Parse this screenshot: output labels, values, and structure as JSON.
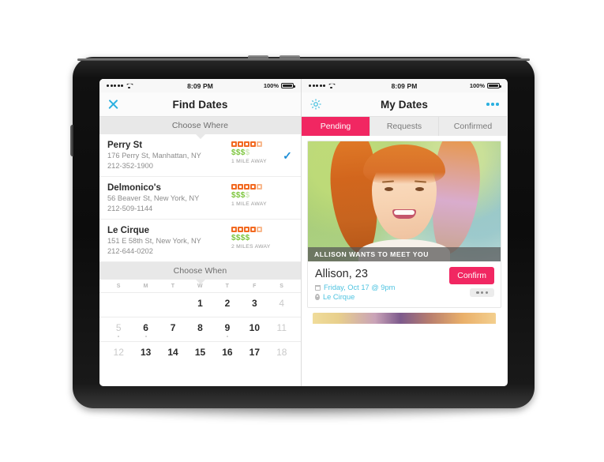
{
  "left_app": {
    "statusbar": {
      "carrier_dots": 5,
      "wifi": "wifi-icon",
      "time": "8:09 PM",
      "battery_pct": "100%"
    },
    "nav": {
      "close_icon": "close-icon",
      "title": "Find Dates"
    },
    "choose_where_label": "Choose Where",
    "restaurants": [
      {
        "name": "Perry St",
        "address": "176 Perry St, Manhattan, NY",
        "phone": "212-352-1900",
        "rating": 4.5,
        "price_on": "$$$",
        "price_off": "$",
        "distance": "1 MILE AWAY",
        "selected": true
      },
      {
        "name": "Delmonico's",
        "address": "56 Beaver St, New York, NY",
        "phone": "212-509-1144",
        "rating": 4.5,
        "price_on": "$$$",
        "price_off": "$",
        "distance": "1 MILE AWAY",
        "selected": false
      },
      {
        "name": "Le Cirque",
        "address": "151 E 58th St, New York, NY",
        "phone": "212-644-0202",
        "rating": 4.5,
        "price_on": "$$$$",
        "price_off": "",
        "distance": "2 MILES AWAY",
        "selected": false
      }
    ],
    "choose_when_label": "Choose When",
    "calendar": {
      "dow": [
        "S",
        "M",
        "T",
        "W",
        "T",
        "F",
        "S"
      ],
      "weeks": [
        [
          {
            "day": "",
            "muted": true,
            "dot": false
          },
          {
            "day": "",
            "muted": true,
            "dot": false
          },
          {
            "day": "",
            "muted": true,
            "dot": false
          },
          {
            "day": "1",
            "muted": false,
            "dot": false
          },
          {
            "day": "2",
            "muted": false,
            "dot": false
          },
          {
            "day": "3",
            "muted": false,
            "dot": false
          },
          {
            "day": "4",
            "muted": true,
            "dot": false
          }
        ],
        [
          {
            "day": "5",
            "muted": true,
            "dot": true
          },
          {
            "day": "6",
            "muted": false,
            "dot": true
          },
          {
            "day": "7",
            "muted": false,
            "dot": false
          },
          {
            "day": "8",
            "muted": false,
            "dot": false
          },
          {
            "day": "9",
            "muted": false,
            "dot": true
          },
          {
            "day": "10",
            "muted": false,
            "dot": false
          },
          {
            "day": "11",
            "muted": true,
            "dot": false
          }
        ],
        [
          {
            "day": "12",
            "muted": true,
            "dot": false
          },
          {
            "day": "13",
            "muted": false,
            "dot": false
          },
          {
            "day": "14",
            "muted": false,
            "dot": false
          },
          {
            "day": "15",
            "muted": false,
            "dot": false
          },
          {
            "day": "16",
            "muted": false,
            "dot": false
          },
          {
            "day": "17",
            "muted": false,
            "dot": false
          },
          {
            "day": "18",
            "muted": true,
            "dot": false
          }
        ]
      ]
    }
  },
  "right_app": {
    "statusbar": {
      "carrier_dots": 5,
      "wifi": "wifi-icon",
      "time": "8:09 PM",
      "battery_pct": "100%"
    },
    "nav": {
      "settings_icon": "gear-icon",
      "title": "My Dates",
      "overflow_icon": "more-icon"
    },
    "tabs": [
      {
        "label": "Pending",
        "active": true
      },
      {
        "label": "Requests",
        "active": false
      },
      {
        "label": "Confirmed",
        "active": false
      }
    ],
    "card": {
      "photo_caption": "ALLISON WANTS TO MEET YOU",
      "name": "Allison, 23",
      "when": "Friday, Oct 17 @ 9pm",
      "where": "Le Cirque",
      "confirm_label": "Confirm",
      "more_icon": "more-icon"
    }
  },
  "colors": {
    "accent_pink": "#f12762",
    "accent_teal": "#4ec3e0",
    "rating_orange": "#f26a22",
    "price_green": "#7ec63f",
    "check_blue": "#1e8fd6"
  }
}
